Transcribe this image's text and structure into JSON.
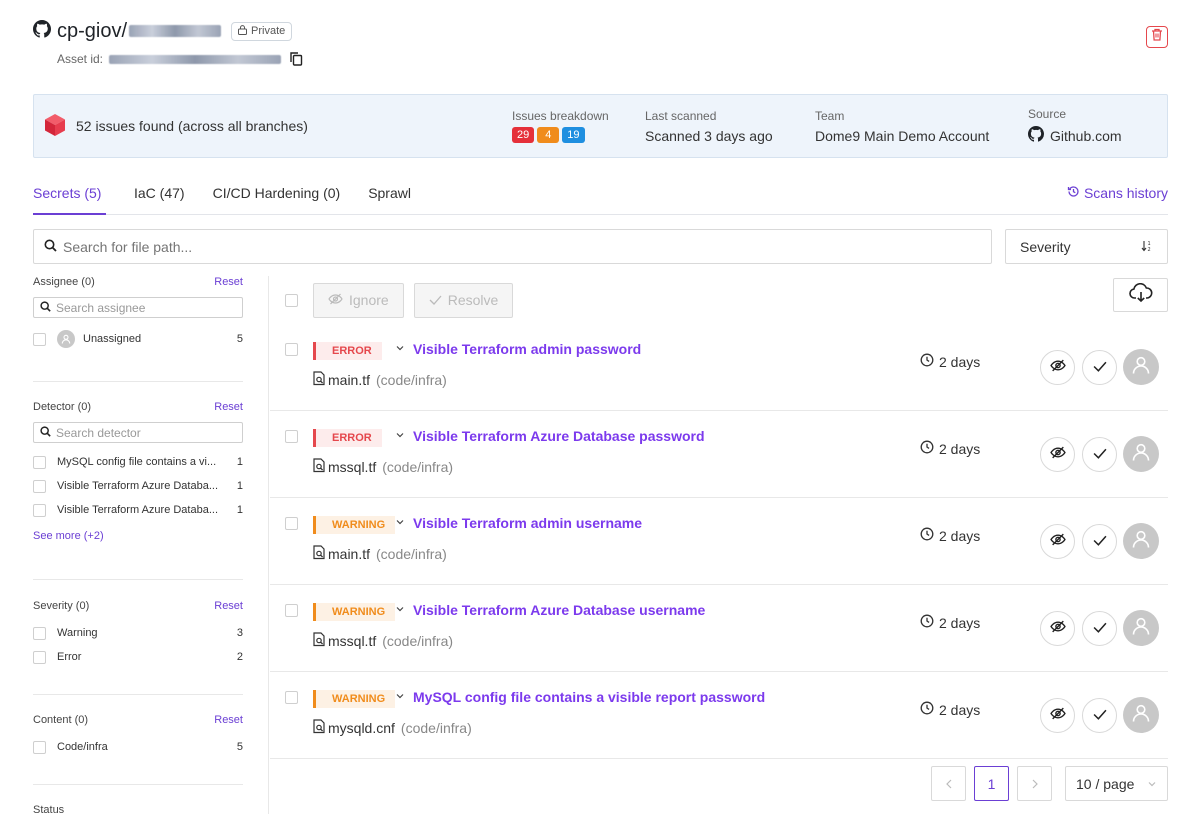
{
  "header": {
    "owner": "cp-giov/",
    "visibility": "Private",
    "asset_id_label": "Asset id:"
  },
  "summary": {
    "issues_text": "52 issues found (across all branches)",
    "breakdown_label": "Issues breakdown",
    "breakdown": {
      "high": "29",
      "medium": "4",
      "low": "19"
    },
    "last_scanned_label": "Last scanned",
    "last_scanned": "Scanned 3 days ago",
    "team_label": "Team",
    "team": "Dome9 Main Demo Account",
    "source_label": "Source",
    "source": "Github.com"
  },
  "tabs": [
    {
      "label": "Secrets (5)"
    },
    {
      "label": "IaC (47)"
    },
    {
      "label": "CI/CD Hardening (0)"
    },
    {
      "label": "Sprawl"
    }
  ],
  "scans_history": "Scans history",
  "search": {
    "placeholder": "Search for file path..."
  },
  "sort": {
    "label": "Severity"
  },
  "filters": {
    "reset_label": "Reset",
    "assignee": {
      "title": "Assignee (0)",
      "placeholder": "Search assignee",
      "items": [
        {
          "label": "Unassigned",
          "count": "5"
        }
      ]
    },
    "detector": {
      "title": "Detector (0)",
      "placeholder": "Search detector",
      "items": [
        {
          "label": "MySQL config file contains a vi...",
          "count": "1"
        },
        {
          "label": "Visible Terraform Azure Databa...",
          "count": "1"
        },
        {
          "label": "Visible Terraform Azure Databa...",
          "count": "1"
        }
      ],
      "see_more": "See more (+2)"
    },
    "severity": {
      "title": "Severity (0)",
      "items": [
        {
          "label": "Warning",
          "count": "3"
        },
        {
          "label": "Error",
          "count": "2"
        }
      ]
    },
    "content": {
      "title": "Content (0)",
      "items": [
        {
          "label": "Code/infra",
          "count": "5"
        }
      ]
    },
    "status": {
      "title": "Status"
    }
  },
  "toolbar": {
    "ignore": "Ignore",
    "resolve": "Resolve"
  },
  "issues": [
    {
      "severity": "ERROR",
      "title": "Visible Terraform admin password",
      "file": "main.tf",
      "path": "(code/infra)",
      "age": "2 days"
    },
    {
      "severity": "ERROR",
      "title": "Visible Terraform Azure Database password",
      "file": "mssql.tf",
      "path": "(code/infra)",
      "age": "2 days"
    },
    {
      "severity": "WARNING",
      "title": "Visible Terraform admin username",
      "file": "main.tf",
      "path": "(code/infra)",
      "age": "2 days"
    },
    {
      "severity": "WARNING",
      "title": "Visible Terraform Azure Database username",
      "file": "mssql.tf",
      "path": "(code/infra)",
      "age": "2 days"
    },
    {
      "severity": "WARNING",
      "title": "MySQL config file contains a visible report password",
      "file": "mysqld.cnf",
      "path": "(code/infra)",
      "age": "2 days"
    }
  ],
  "pagination": {
    "current": "1",
    "page_size": "10 / page"
  },
  "colors": {
    "accent": "#6b3fd4",
    "error": "#e5484d",
    "warning": "#f08c1c",
    "badge_high": "#e5303a",
    "badge_medium": "#f08c1c",
    "badge_low": "#1f8fe0"
  }
}
